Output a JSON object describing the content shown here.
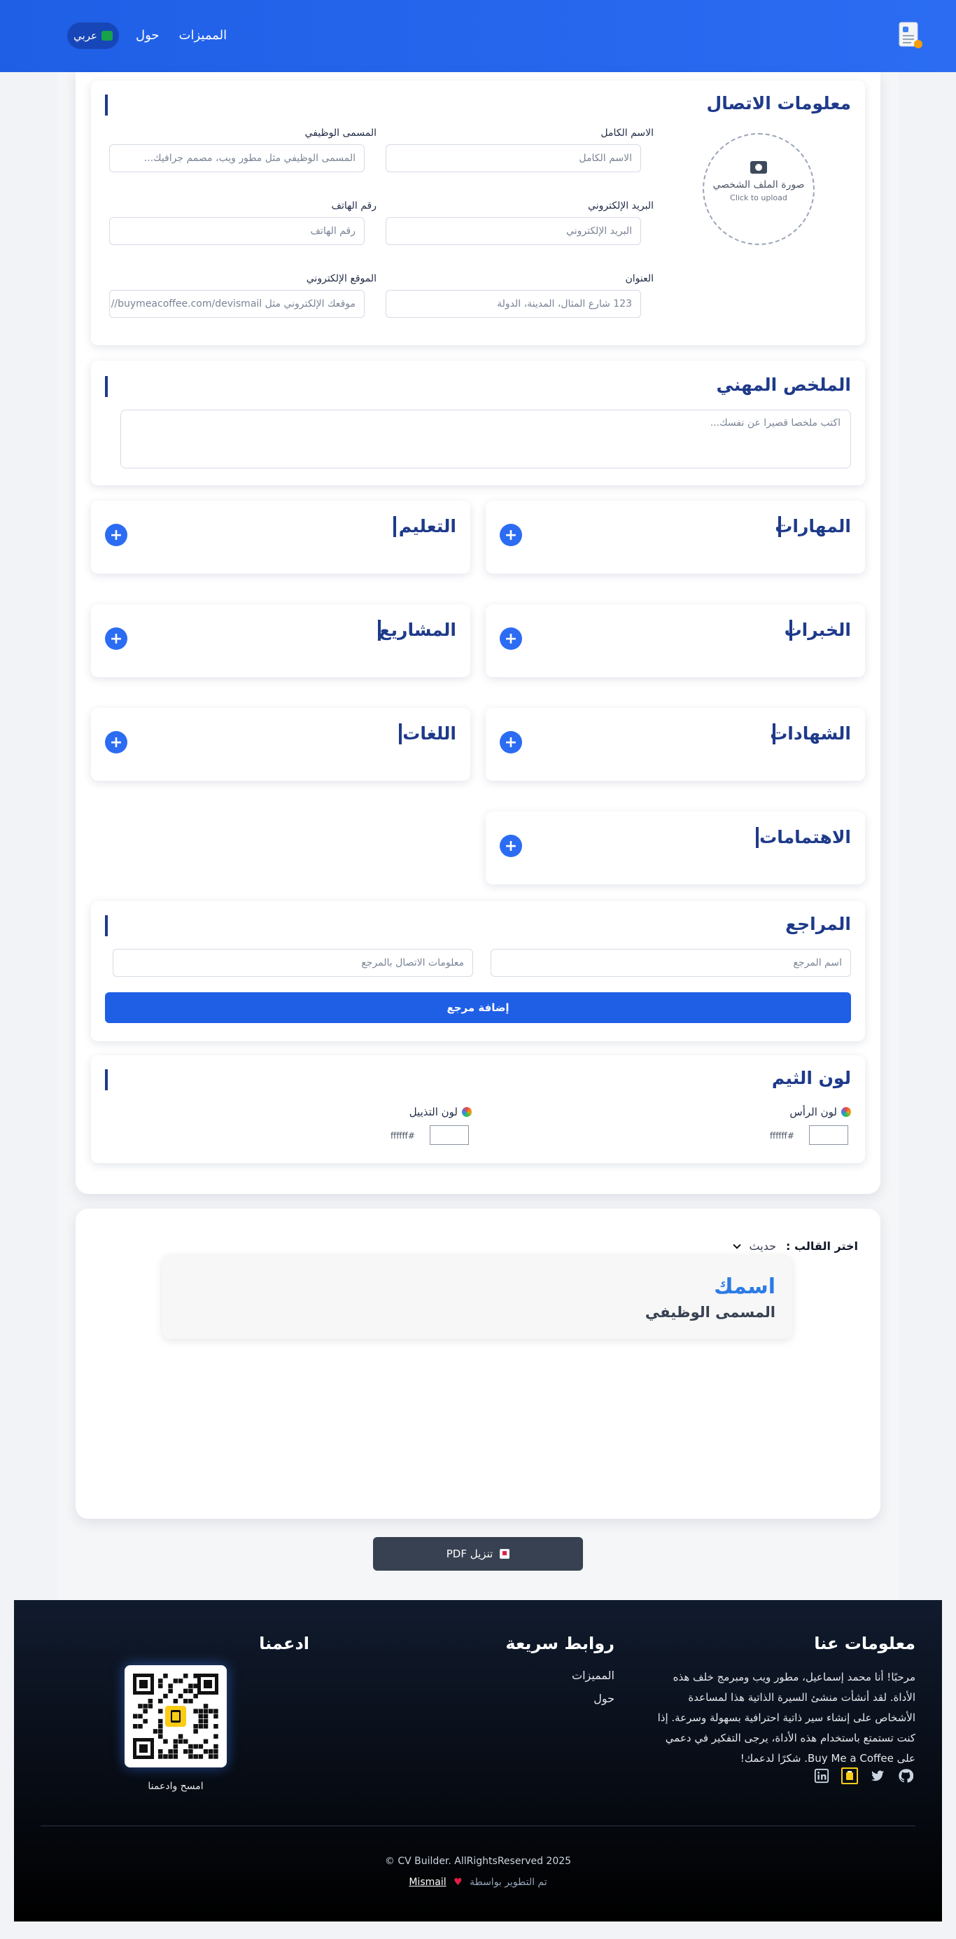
{
  "nav": {
    "links": [
      "المميزات",
      "حول"
    ],
    "language": "عربي"
  },
  "contact": {
    "title": "معلومات الاتصال",
    "photo_label": "صورة الملف الشخصي",
    "photo_hint": "Click to upload",
    "fields": {
      "full_name": {
        "label": "الاسم الكامل",
        "placeholder": "الاسم الكامل"
      },
      "job_title": {
        "label": "المسمى الوظيفي",
        "placeholder": "المسمى الوظيفي مثل مطور ويب، مصمم جرافيك..."
      },
      "email": {
        "label": "البريد الإلكتروني",
        "placeholder": "البريد الإلكتروني"
      },
      "phone": {
        "label": "رقم الهاتف",
        "placeholder": "رقم الهاتف"
      },
      "address": {
        "label": "العنوان",
        "placeholder": "123 شارع المثال، المدينة، الدولة"
      },
      "website": {
        "label": "الموقع الإلكتروني",
        "placeholder": "موقعك الإلكتروني مثل https://buymeacoffee.com/devismail"
      }
    }
  },
  "summary": {
    "title": "الملخص المهني",
    "placeholder": "اكتب ملخصا قصيرا عن نفسك..."
  },
  "sections": {
    "skills": "المهارات",
    "education": "التعليم",
    "experience": "الخبرات",
    "projects": "المشاريع",
    "certificates": "الشهادات",
    "languages": "اللغات",
    "interests": "الاهتمامات",
    "add_symbol": "+"
  },
  "references": {
    "title": "المراجع",
    "name_placeholder": "اسم المرجع",
    "contact_placeholder": "معلومات الاتصال بالمرجع",
    "add_button": "إضافة مرجع"
  },
  "theme": {
    "title": "لون الثيم",
    "header_label": "لون الرأس",
    "header_value": "#ffffff",
    "footer_label": "لون التذييل",
    "footer_value": "#ffffff"
  },
  "preview": {
    "template_label": "اختر القالب :",
    "template_value": "حديث",
    "cv_name": "اسمك",
    "cv_job": "المسمى الوظيفي"
  },
  "download_button": "تنزيل PDF",
  "footer": {
    "about_title": "معلومات عنا",
    "about_text": "مرحبًا! أنا محمد إسماعيل، مطور ويب ومبرمج خلف هذه الأداة. لقد أنشأت منشئ السيرة الذاتية هذا لمساعدة الأشخاص على إنشاء سير ذاتية احترافية بسهولة وسرعة. إذا كنت تستمتع باستخدام هذه الأداة، يرجى التفكير في دعمي على Buy Me a Coffee. شكرًا لدعمك!",
    "links_title": "روابط سريعة",
    "links": [
      "المميزات",
      "حول"
    ],
    "support_title": "ادعمنا",
    "qr_caption": "امسح وادعمنا",
    "copyright": "CV Builder. AllRightsReserved 2025 ©",
    "credit_prefix": "تم التطوير بواسطة",
    "credit_name": "Mismail"
  },
  "colors": {
    "primary": "#1f5fe6",
    "heading": "#1e3a8a",
    "accent_blue": "#2b6cf3",
    "footer_bg": "#0b1220"
  }
}
